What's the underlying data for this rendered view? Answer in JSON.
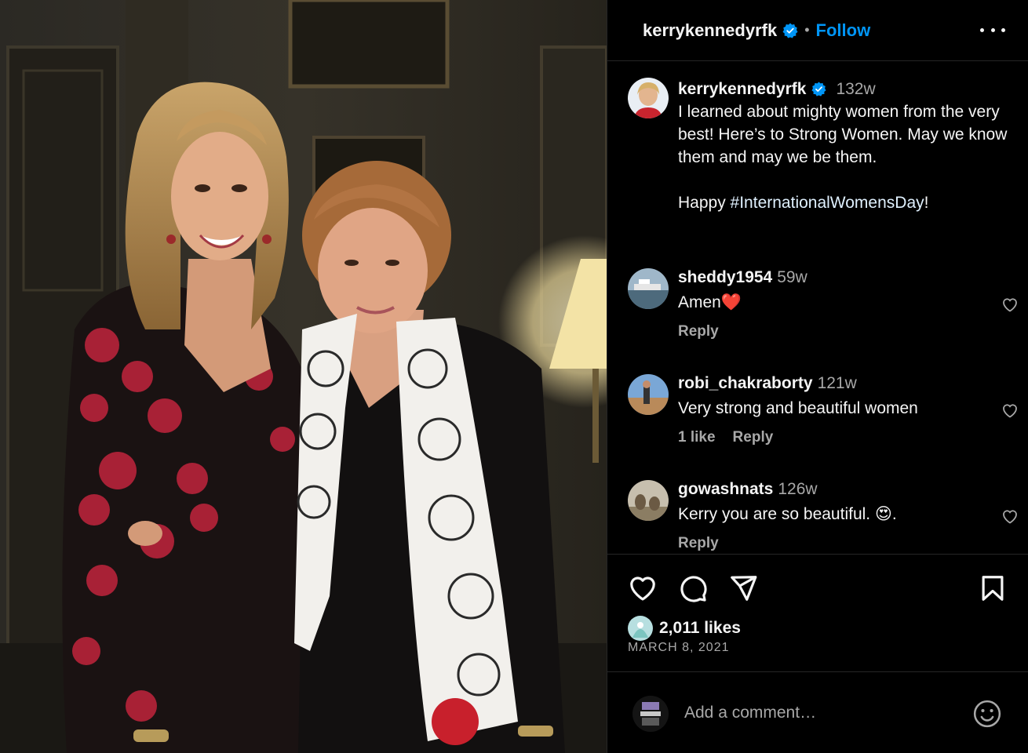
{
  "post": {
    "author": "kerrykennedyrfk",
    "separator": "•",
    "follow_label": "Follow",
    "more_icon": "more-horizontal-icon",
    "accent_color": "#0095f6",
    "verified_color": "#0095f6"
  },
  "caption": {
    "username": "kerrykennedyrfk",
    "time": "132w",
    "text": "I learned about mighty women from the very best! Here’s to Strong Women. May we know them and may we be them.",
    "happy": "Happy ",
    "hashtag": "#InternationalWomensDay",
    "end": "!"
  },
  "comments": [
    {
      "username": "sheddy1954",
      "time": "59w",
      "text": "Amen",
      "emoji": "❤️",
      "likes": "",
      "reply": "Reply"
    },
    {
      "username": "robi_chakraborty",
      "time": "121w",
      "text": "Very strong and beautiful women",
      "emoji": "",
      "likes": "1 like",
      "reply": "Reply"
    },
    {
      "username": "gowashnats",
      "time": "126w",
      "text": "Kerry you are so beautiful. ",
      "emoji": "😍.",
      "likes": "",
      "reply": "Reply"
    }
  ],
  "actions": {
    "like_icon": "heart-icon",
    "comment_icon": "comment-icon",
    "share_icon": "share-icon",
    "save_icon": "bookmark-icon",
    "likes_count": "2,011 likes",
    "date": "MARCH 8, 2021"
  },
  "comment_box": {
    "placeholder": "Add a comment…",
    "emoji_icon": "smiley-icon"
  }
}
